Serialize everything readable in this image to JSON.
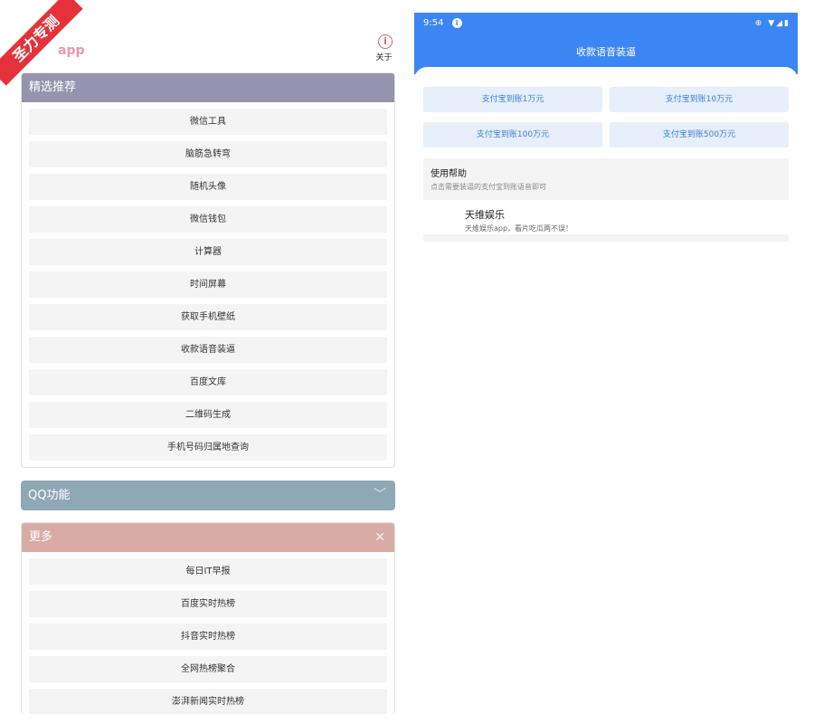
{
  "left": {
    "ribbon": "圣力专测",
    "app_title": "app",
    "about_label": "关于",
    "cards": [
      {
        "title": "精选推荐",
        "color": "#9693ae",
        "items": [
          "微信工具",
          "脑筋急转弯",
          "随机头像",
          "微信钱包",
          "计算器",
          "时间屏幕",
          "获取手机壁纸",
          "收款语音装逼",
          "百度文库",
          "二维码生成",
          "手机号码归属地查询"
        ]
      },
      {
        "title": "QQ功能",
        "color": "#8fa8b5",
        "icon": "chevron-down-icon"
      },
      {
        "title": "更多",
        "color": "#d8aca4",
        "icon": "close-icon",
        "items": [
          "每日IT早报",
          "百度实时热榜",
          "抖音实时热榜",
          "全网热榜聚合",
          "澎湃新闻实时热榜"
        ]
      }
    ]
  },
  "right": {
    "status": {
      "time": "9:54",
      "icons": "⊕ ▼◢▮"
    },
    "toolbar_title": "收款语音装逼",
    "buttons": [
      "支付宝到账1万元",
      "支付宝到账10万元",
      "支付宝到账100万元",
      "支付宝到账500万元"
    ],
    "help": {
      "title": "使用帮助",
      "subtitle": "点击需要装逼的支付宝到账语音即可"
    },
    "promo": {
      "title": "天维娱乐",
      "subtitle": "天维娱乐app，看片吃瓜两不误！"
    },
    "accent_color": "#3b86f2"
  }
}
